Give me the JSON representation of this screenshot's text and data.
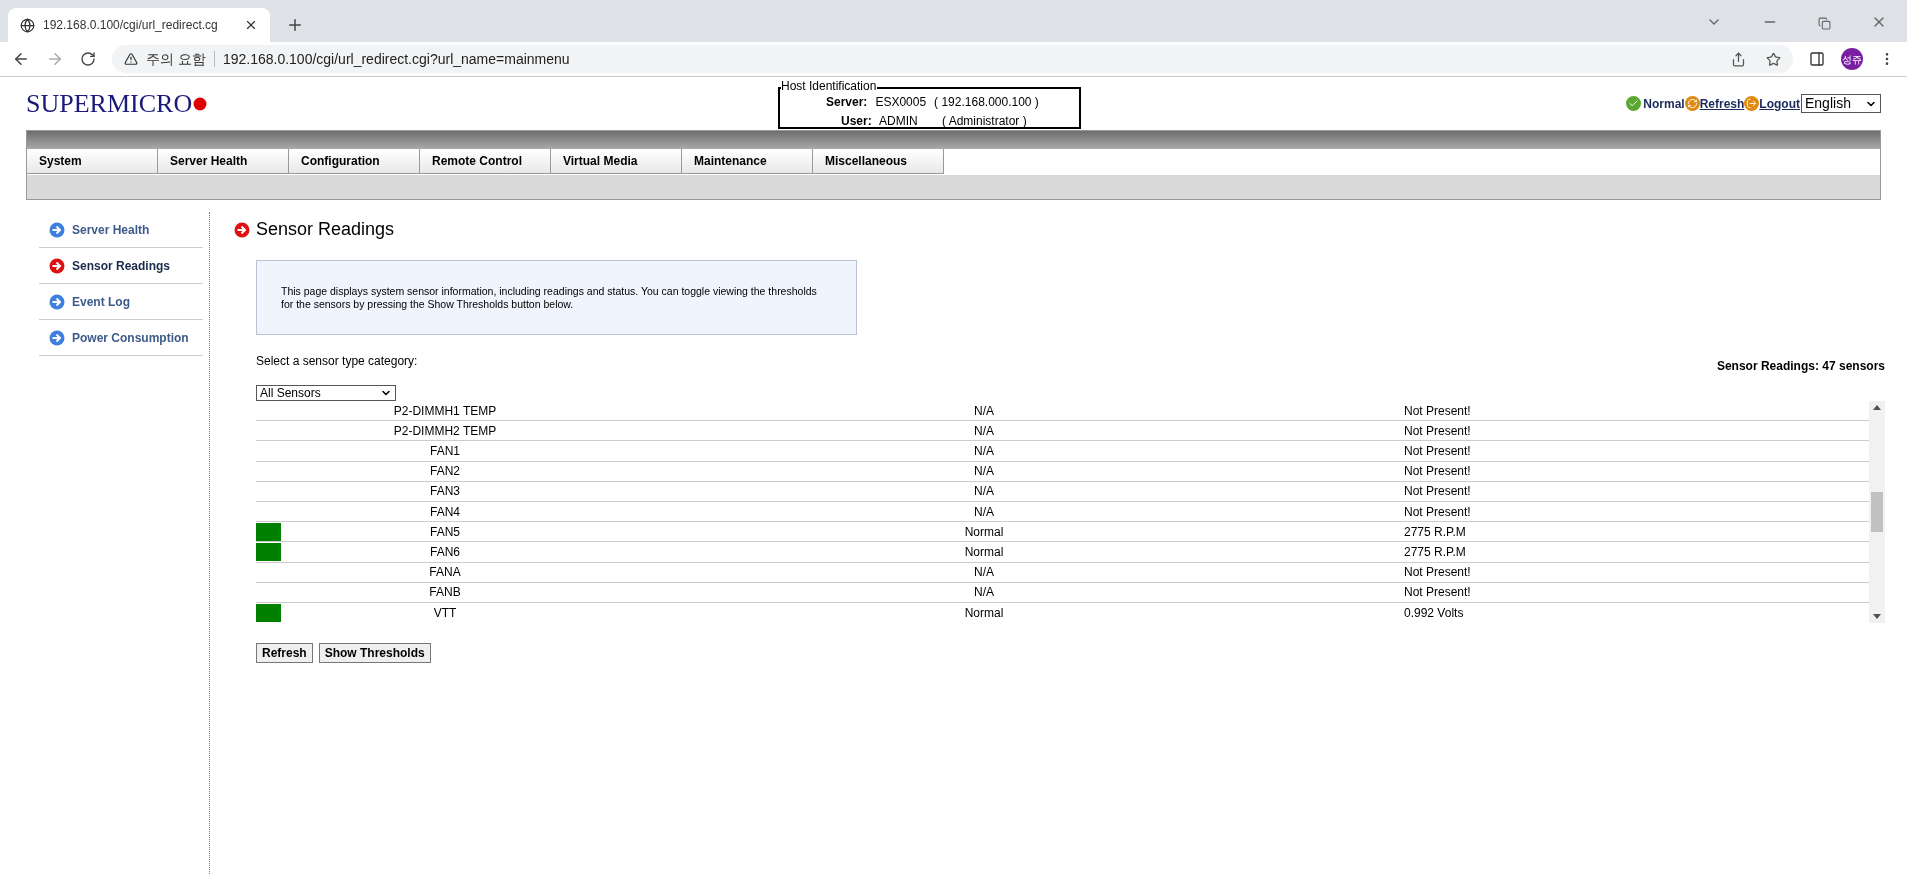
{
  "browser": {
    "tab_title": "192.168.0.100/cgi/url_redirect.cg",
    "security_label": "주의 요함",
    "url": "192.168.0.100/cgi/url_redirect.cgi?url_name=mainmenu",
    "profile": "성쥬"
  },
  "header": {
    "logo": "SUPERMICRO",
    "host_identification": {
      "legend": "Host Identification",
      "server_label": "Server:",
      "server_name": "ESX0005",
      "server_ip": "( 192.168.000.100 )",
      "user_label": "User:",
      "user_name": "ADMIN",
      "user_role": "( Administrator )"
    },
    "status": "Normal",
    "refresh": "Refresh",
    "logout": "Logout",
    "language": "English"
  },
  "menu": [
    "System",
    "Server Health",
    "Configuration",
    "Remote Control",
    "Virtual Media",
    "Maintenance",
    "Miscellaneous"
  ],
  "sidebar": {
    "items": [
      {
        "label": "Server Health",
        "selected": false
      },
      {
        "label": "Sensor Readings",
        "selected": true
      },
      {
        "label": "Event Log",
        "selected": false
      },
      {
        "label": "Power Consumption",
        "selected": false
      }
    ]
  },
  "page": {
    "title": "Sensor Readings",
    "info": "This page displays system sensor information, including readings and status. You can toggle viewing the thresholds for the sensors by pressing the Show Thresholds button below.",
    "category_label": "Select a sensor type category:",
    "category": "All Sensors",
    "count": "Sensor Readings: 47 sensors"
  },
  "table": {
    "rows": [
      {
        "name": "P2-DIMMH1 TEMP",
        "status": "N/A",
        "reading": "Not Present!"
      },
      {
        "name": "P2-DIMMH2 TEMP",
        "status": "N/A",
        "reading": "Not Present!"
      },
      {
        "name": "FAN1",
        "status": "N/A",
        "reading": "Not Present!"
      },
      {
        "name": "FAN2",
        "status": "N/A",
        "reading": "Not Present!"
      },
      {
        "name": "FAN3",
        "status": "N/A",
        "reading": "Not Present!"
      },
      {
        "name": "FAN4",
        "status": "N/A",
        "reading": "Not Present!"
      },
      {
        "name": "FAN5",
        "status": "Normal",
        "reading": "2775 R.P.M",
        "color": "#008000"
      },
      {
        "name": "FAN6",
        "status": "Normal",
        "reading": "2775 R.P.M",
        "color": "#008000"
      },
      {
        "name": "FANA",
        "status": "N/A",
        "reading": "Not Present!"
      },
      {
        "name": "FANB",
        "status": "N/A",
        "reading": "Not Present!"
      },
      {
        "name": "VTT",
        "status": "Normal",
        "reading": "0.992 Volts",
        "color": "#008000"
      }
    ]
  },
  "buttons": [
    "Refresh",
    "Show Thresholds"
  ]
}
